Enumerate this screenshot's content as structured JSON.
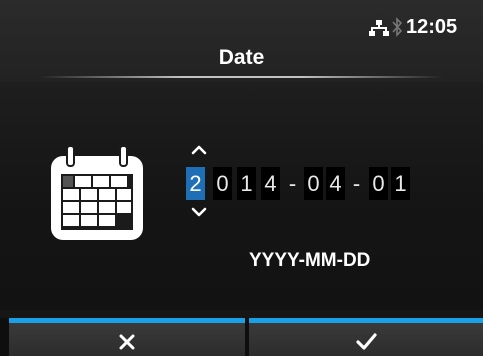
{
  "status_bar": {
    "time": "12:05",
    "icons": [
      "network-icon",
      "bluetooth-icon"
    ]
  },
  "title": "Date",
  "date_input": {
    "digits": [
      "2",
      "0",
      "1",
      "4",
      "0",
      "4",
      "0",
      "1"
    ],
    "separator": "-",
    "active_digit_index": 0,
    "format": "YYYY-MM-DD"
  },
  "buttons": {
    "cancel_icon": "close-icon",
    "confirm_icon": "check-icon"
  },
  "colors": {
    "accent": "#1aa0e6",
    "active_digit": "#1f6fb6"
  }
}
